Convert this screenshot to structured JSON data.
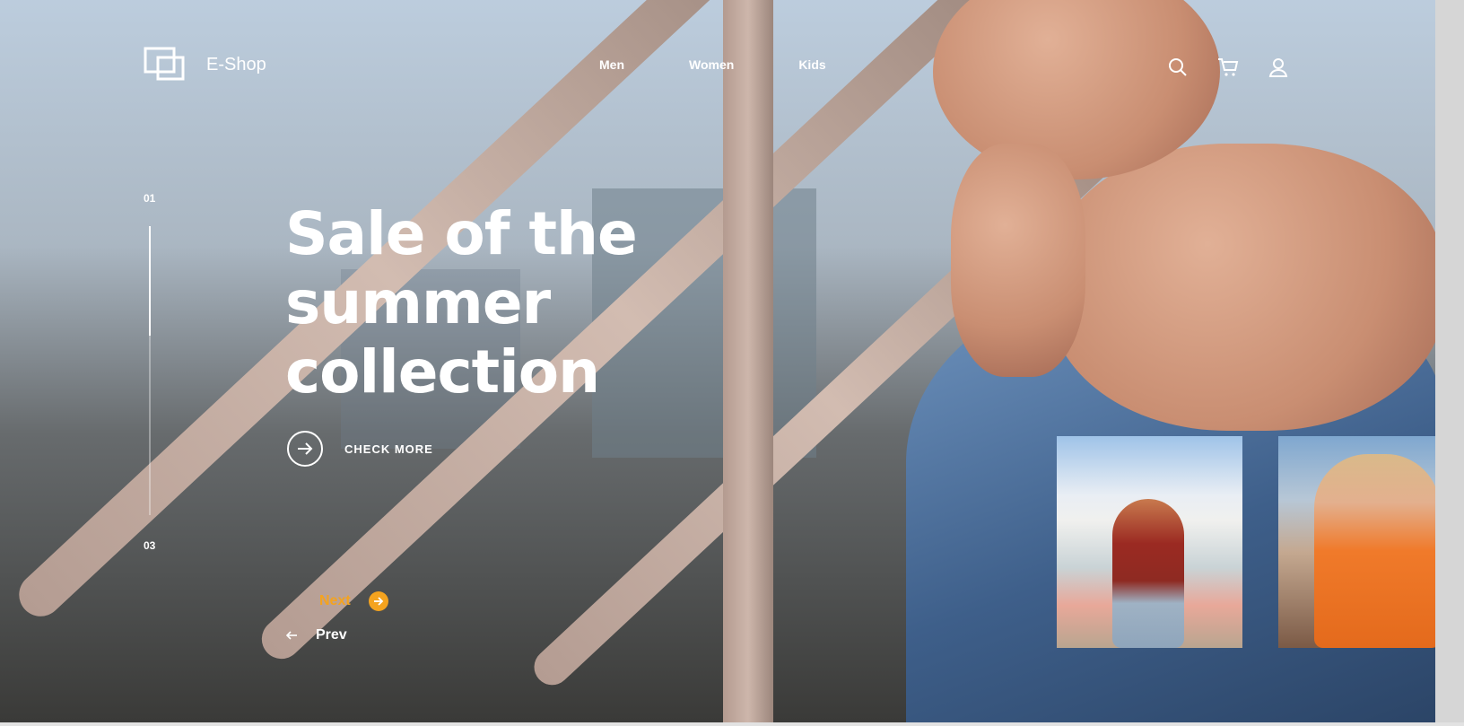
{
  "brand": {
    "name": "E-Shop"
  },
  "nav": {
    "items": [
      {
        "label": "Men"
      },
      {
        "label": "Women"
      },
      {
        "label": "Kids"
      }
    ]
  },
  "header_icons": [
    "search-icon",
    "cart-icon",
    "user-icon"
  ],
  "slider": {
    "current": "01",
    "total": "03",
    "progress": 0.38
  },
  "hero": {
    "headline_lines": [
      "Sale of the",
      "summer",
      "collection"
    ],
    "cta_label": "CHECK MORE"
  },
  "pager": {
    "next_label": "Next",
    "prev_label": "Prev"
  },
  "colors": {
    "accent": "#f4a31f",
    "text": "#ffffff"
  }
}
